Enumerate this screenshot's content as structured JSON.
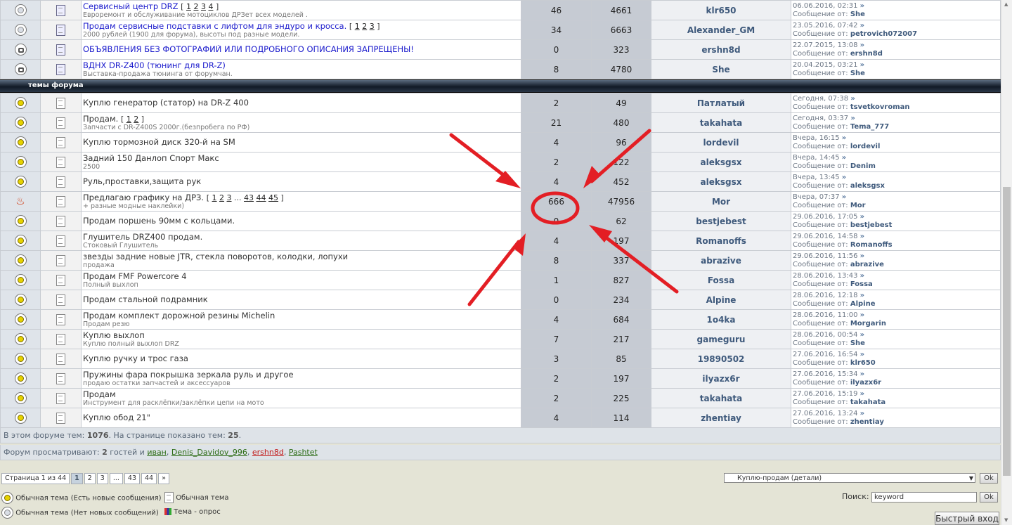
{
  "sticky_topics": [
    {
      "title": "Сервисный центр DRZ",
      "pages": [
        "1",
        "2",
        "3",
        "4"
      ],
      "desc": "Евроремонт и обслуживание мотоциклов ДРЗет всех моделей .",
      "replies": "46",
      "views": "4661",
      "author": "klr650",
      "last_date": "06.06.2016, 02:31",
      "last_by": "She",
      "icon": "circle-plain",
      "type": "pinned"
    },
    {
      "title": "Продам сервисные подставки с лифтом для эндуро и кросса.",
      "pages": [
        "1",
        "2",
        "3"
      ],
      "desc": "2000 рублей (1900 для форума), высоты под разные модели.",
      "replies": "34",
      "views": "6663",
      "author": "Alexander_GM",
      "last_date": "23.05.2016, 07:42",
      "last_by": "petrovich072007",
      "icon": "circle-plain",
      "type": "pinned"
    },
    {
      "title": "ОБЪЯВЛЕНИЯ БЕЗ ФОТОГРАФИЙ ИЛИ ПОДРОБНОГО ОПИСАНИЯ ЗАПРЕЩЕНЫ!",
      "pages": [],
      "desc": "",
      "replies": "0",
      "views": "323",
      "author": "ershn8d",
      "last_date": "22.07.2015, 13:08",
      "last_by": "ershn8d",
      "icon": "lock",
      "type": "pinned"
    },
    {
      "title": "ВДНХ DR-Z400 (тюнинг для DR-Z)",
      "pages": [],
      "desc": "Выставка-продажа тюнинга от форумчан.",
      "replies": "8",
      "views": "4780",
      "author": "She",
      "last_date": "20.04.2015, 03:21",
      "last_by": "She",
      "icon": "lock",
      "type": "pinned"
    }
  ],
  "section_title": "темы форума",
  "last_post_prefix": "Сообщение от:",
  "topics": [
    {
      "title": "Куплю генератор (статор) на DR-Z 400",
      "pages": [],
      "desc": "",
      "replies": "2",
      "views": "49",
      "author": "Патлатый",
      "last_date": "Сегодня, 07:38",
      "last_by": "tsvetkovroman",
      "icon": "circle-new"
    },
    {
      "title": "Продам.",
      "pages": [
        "1",
        "2"
      ],
      "desc": "Запчасти с DR-Z400S 2000г.(безпробега по РФ)",
      "replies": "21",
      "views": "480",
      "author": "takahata",
      "last_date": "Сегодня, 03:37",
      "last_by": "Tema_777",
      "icon": "circle-new"
    },
    {
      "title": "Куплю тормозной диск 320-й на SM",
      "pages": [],
      "desc": "",
      "replies": "4",
      "views": "96",
      "author": "lordevil",
      "last_date": "Вчера, 16:15",
      "last_by": "lordevil",
      "icon": "circle-new"
    },
    {
      "title": "Задний 150 Данлоп Спорт Макс",
      "pages": [],
      "desc": "2500",
      "replies": "2",
      "views": "122",
      "author": "aleksgsx",
      "last_date": "Вчера, 14:45",
      "last_by": "Denim",
      "icon": "circle-new"
    },
    {
      "title": "Руль,проставки,защита рук",
      "pages": [],
      "desc": "",
      "replies": "4",
      "views": "452",
      "author": "aleksgsx",
      "last_date": "Вчера, 13:45",
      "last_by": "aleksgsx",
      "icon": "circle-new"
    },
    {
      "title": "Предлагаю графику на ДРЗ.",
      "pages": [
        "1",
        "2",
        "3",
        "...",
        "43",
        "44",
        "45"
      ],
      "desc": "+ разные модные наклейки)",
      "replies": "666",
      "views": "47956",
      "author": "Mor",
      "last_date": "Вчера, 07:37",
      "last_by": "Mor",
      "icon": "fire"
    },
    {
      "title": "Продам поршень 90мм с кольцами.",
      "pages": [],
      "desc": "",
      "replies": "0",
      "views": "62",
      "author": "bestjebest",
      "last_date": "29.06.2016, 17:05",
      "last_by": "bestjebest",
      "icon": "circle-new"
    },
    {
      "title": "Глушитель DRZ400 продам.",
      "pages": [],
      "desc": "Стоковый Глушитель",
      "replies": "4",
      "views": "197",
      "author": "Romanoffs",
      "last_date": "29.06.2016, 14:58",
      "last_by": "Romanoffs",
      "icon": "circle-new"
    },
    {
      "title": "звезды задние новые JTR, стекла поворотов, колодки, лопухи",
      "pages": [],
      "desc": "продажа",
      "replies": "8",
      "views": "337",
      "author": "abrazive",
      "last_date": "29.06.2016, 11:56",
      "last_by": "abrazive",
      "icon": "circle-new"
    },
    {
      "title": "Продам FMF Powercore 4",
      "pages": [],
      "desc": "Полный выхлоп",
      "replies": "1",
      "views": "827",
      "author": "Fossa",
      "last_date": "28.06.2016, 13:43",
      "last_by": "Fossa",
      "icon": "circle-new"
    },
    {
      "title": "Продам стальной подрамник",
      "pages": [],
      "desc": "",
      "replies": "0",
      "views": "234",
      "author": "Alpine",
      "last_date": "28.06.2016, 12:18",
      "last_by": "Alpine",
      "icon": "circle-new"
    },
    {
      "title": "Продам комплект дорожной резины Michelin",
      "pages": [],
      "desc": "Продам резю",
      "replies": "4",
      "views": "684",
      "author": "1o4ka",
      "last_date": "28.06.2016, 11:00",
      "last_by": "Morgarin",
      "icon": "circle-new"
    },
    {
      "title": "Куплю выхлоп",
      "pages": [],
      "desc": "Куплю полный выхлоп DRZ",
      "replies": "7",
      "views": "217",
      "author": "gameguru",
      "last_date": "28.06.2016, 00:54",
      "last_by": "She",
      "icon": "circle-new"
    },
    {
      "title": "Куплю ручку и трос газа",
      "pages": [],
      "desc": "",
      "replies": "3",
      "views": "85",
      "author": "19890502",
      "last_date": "27.06.2016, 16:54",
      "last_by": "klr650",
      "icon": "circle-new"
    },
    {
      "title": "Пружины фара покрышка зеркала руль и другое",
      "pages": [],
      "desc": "продаю остатки запчастей и аксессуаров",
      "replies": "2",
      "views": "197",
      "author": "ilyazx6r",
      "last_date": "27.06.2016, 15:34",
      "last_by": "ilyazx6r",
      "icon": "circle-new"
    },
    {
      "title": "Продам",
      "pages": [],
      "desc": "Инструмент для расклёпки/заклёпки цепи на мото",
      "replies": "2",
      "views": "225",
      "author": "takahata",
      "last_date": "27.06.2016, 15:19",
      "last_by": "takahata",
      "icon": "circle-new"
    },
    {
      "title": "Куплю обод 21\"",
      "pages": [],
      "desc": "",
      "replies": "4",
      "views": "114",
      "author": "zhentiay",
      "last_date": "27.06.2016, 13:24",
      "last_by": "zhentiay",
      "icon": "circle-new"
    }
  ],
  "stats": {
    "prefix": "В этом форуме тем:",
    "total": "1076",
    "shown_label": ". На странице показано тем:",
    "shown": "25",
    "end": "."
  },
  "viewers": {
    "prefix": "Форум просматривают:",
    "guests": "2",
    "guests_label": "гостей и",
    "users": [
      {
        "name": "иван",
        "color": "green"
      },
      {
        "name": "Denis_Davidov_996",
        "color": "green"
      },
      {
        "name": "ershn8d",
        "color": "red"
      },
      {
        "name": "Pashtet",
        "color": "green"
      }
    ]
  },
  "pager": {
    "label": "Страница 1 из 44",
    "pages": [
      "1",
      "2",
      "3",
      "...",
      "43",
      "44",
      "»"
    ],
    "current": "1"
  },
  "jump": {
    "selected": "Куплю-продам (детали)",
    "ok": "Ok"
  },
  "legend": [
    {
      "text": "Обычная тема (Есть новые сообщения)",
      "icon": "circle-new-icon"
    },
    {
      "text": "Обычная тема",
      "icon": "document-icon"
    },
    {
      "text": "Обычная тема (Нет новых сообщений)",
      "icon": "circle-plain-icon"
    },
    {
      "text": "Тема - опрос",
      "icon": "poll-icon"
    }
  ],
  "search": {
    "label": "Поиск:",
    "value": "keyword",
    "ok": "Ok"
  },
  "quick_login": "Быстрый вход",
  "colors": {
    "accent": "#1a1acc",
    "arrow": "#e31e24",
    "header_dark": "#111a26",
    "author": "#3f5a7c"
  }
}
